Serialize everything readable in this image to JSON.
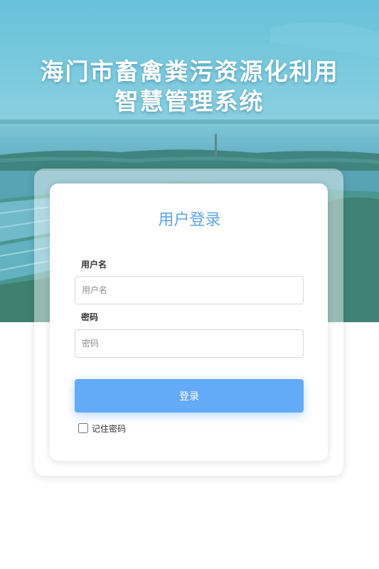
{
  "header": {
    "title_line1": "海门市畜禽粪污资源化利用",
    "title_line2": "智慧管理系统"
  },
  "login": {
    "heading": "用户登录",
    "username_label": "用户名",
    "username_placeholder": "用户名",
    "username_value": "",
    "password_label": "密码",
    "password_placeholder": "密码",
    "password_value": "",
    "submit_label": "登录",
    "remember_label": "记住密码",
    "remember_checked": false
  },
  "colors": {
    "accent": "#5aa6f0",
    "button": "#63aaf8",
    "sky": "#6cc3d9"
  }
}
